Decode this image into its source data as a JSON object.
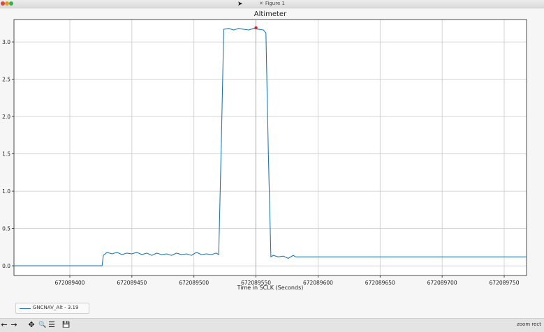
{
  "window": {
    "title": "Figure 1"
  },
  "toolbar": {
    "buttons": [
      {
        "name": "back-icon",
        "glyph": "←"
      },
      {
        "name": "forward-icon",
        "glyph": "→"
      },
      {
        "name": "pan-icon",
        "glyph": "✥"
      },
      {
        "name": "zoom-icon",
        "glyph": "🔍"
      },
      {
        "name": "configure-subplots-icon",
        "glyph": "☰"
      },
      {
        "name": "save-icon",
        "glyph": "💾"
      }
    ],
    "status": "zoom rect"
  },
  "chart_data": {
    "type": "line",
    "title": "Altimeter",
    "xlabel": "Time in SCLK (Seconds)",
    "ylabel": "",
    "xlim": [
      672089355,
      672089768
    ],
    "ylim": [
      -0.13,
      3.3
    ],
    "grid": true,
    "legend_placement": "below-left",
    "xticks": [
      672089400,
      672089450,
      672089500,
      672089550,
      672089600,
      672089650,
      672089700,
      672089750
    ],
    "xtick_labels": [
      "672089400",
      "672089450",
      "672089500",
      "672089550",
      "672089600",
      "672089650",
      "672089700",
      "672089750"
    ],
    "yticks": [
      0.0,
      0.5,
      1.0,
      1.5,
      2.0,
      2.5,
      3.0
    ],
    "ytick_labels": [
      "0.0",
      "0.5",
      "1.0",
      "1.5",
      "2.0",
      "2.5",
      "3.0"
    ],
    "cursor": {
      "x": 672089550,
      "y": 3.19,
      "color": "#d62728"
    },
    "series": [
      {
        "name": "GNCNAV_Alt - 3.19",
        "color": "#1f77b4",
        "x": [
          672089355,
          672089426,
          672089427,
          672089430,
          672089434,
          672089438,
          672089442,
          672089446,
          672089450,
          672089454,
          672089458,
          672089462,
          672089466,
          672089470,
          672089474,
          672089478,
          672089482,
          672089486,
          672089490,
          672089494,
          672089498,
          672089502,
          672089506,
          672089510,
          672089514,
          672089518,
          672089520,
          672089522,
          672089524,
          672089528,
          672089532,
          672089536,
          672089540,
          672089544,
          672089548,
          672089552,
          672089556,
          672089558,
          672089560,
          672089562,
          672089564,
          672089568,
          672089572,
          672089576,
          672089580,
          672089582,
          672089586,
          672089768
        ],
        "y": [
          0.0,
          0.0,
          0.14,
          0.18,
          0.16,
          0.18,
          0.15,
          0.17,
          0.16,
          0.18,
          0.15,
          0.17,
          0.14,
          0.17,
          0.15,
          0.16,
          0.14,
          0.17,
          0.15,
          0.16,
          0.14,
          0.18,
          0.15,
          0.16,
          0.15,
          0.17,
          0.15,
          1.6,
          3.17,
          3.18,
          3.16,
          3.18,
          3.17,
          3.16,
          3.18,
          3.17,
          3.16,
          3.12,
          1.5,
          0.12,
          0.14,
          0.12,
          0.13,
          0.1,
          0.14,
          0.12,
          0.12,
          0.12
        ]
      }
    ]
  }
}
